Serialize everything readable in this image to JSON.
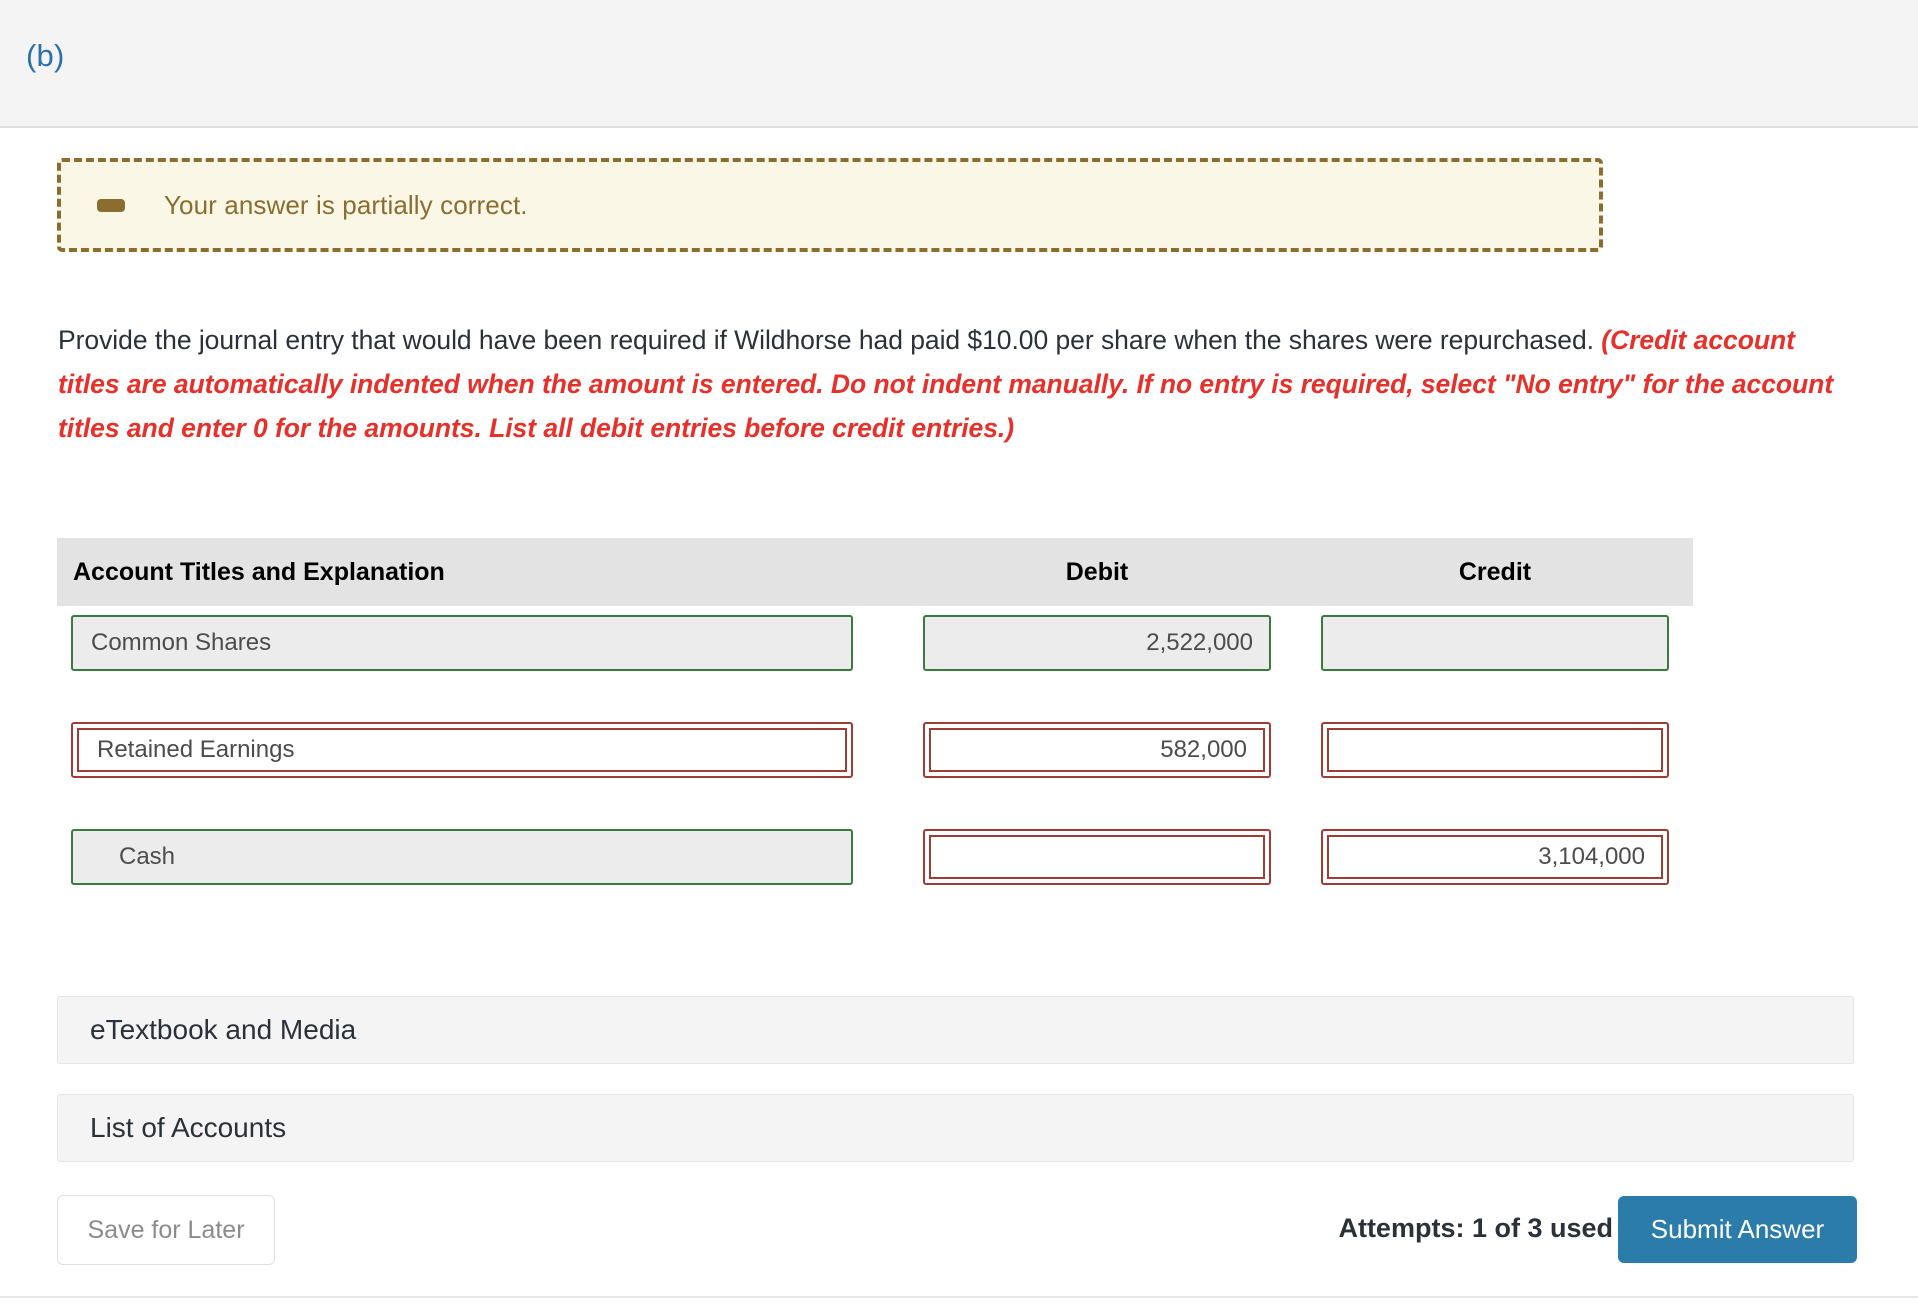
{
  "header": {
    "part_label": "(b)"
  },
  "alert": {
    "icon": "minus-icon",
    "message": "Your answer is partially correct."
  },
  "instruction": {
    "main": "Provide the journal entry that would have been required if Wildhorse had paid $10.00 per share when the shares were repurchased. ",
    "hint": "(Credit account titles are automatically indented when the amount is entered. Do not indent manually. If no entry is required, select \"No entry\" for the account titles and enter 0 for the amounts. List all debit entries before credit entries.)"
  },
  "journal": {
    "columns": [
      "Account Titles and Explanation",
      "Debit",
      "Credit"
    ],
    "rows": [
      {
        "account": "Common Shares",
        "account_state": "correct",
        "account_indent": false,
        "debit": "2,522,000",
        "debit_state": "correct",
        "credit": "",
        "credit_state": "correct"
      },
      {
        "account": "Retained Earnings",
        "account_state": "incorrect",
        "account_indent": false,
        "debit": "582,000",
        "debit_state": "incorrect",
        "credit": "",
        "credit_state": "incorrect"
      },
      {
        "account": "Cash",
        "account_state": "correct",
        "account_indent": true,
        "debit": "",
        "debit_state": "incorrect",
        "credit": "3,104,000",
        "credit_state": "incorrect"
      }
    ]
  },
  "resources": {
    "etextbook_label": "eTextbook and Media",
    "accounts_label": "List of Accounts"
  },
  "footer": {
    "save_label": "Save for Later",
    "attempts_label": "Attempts: 1 of 3 used",
    "submit_label": "Submit Answer"
  },
  "colors": {
    "accent_blue": "#2a72ab",
    "submit_blue": "#2b7bab",
    "alert_brown": "#8a6d2f",
    "alert_bg": "#faf7e6",
    "hint_red": "#e8302a",
    "correct_green": "#3b7a3f",
    "incorrect_red": "#a03c36"
  }
}
